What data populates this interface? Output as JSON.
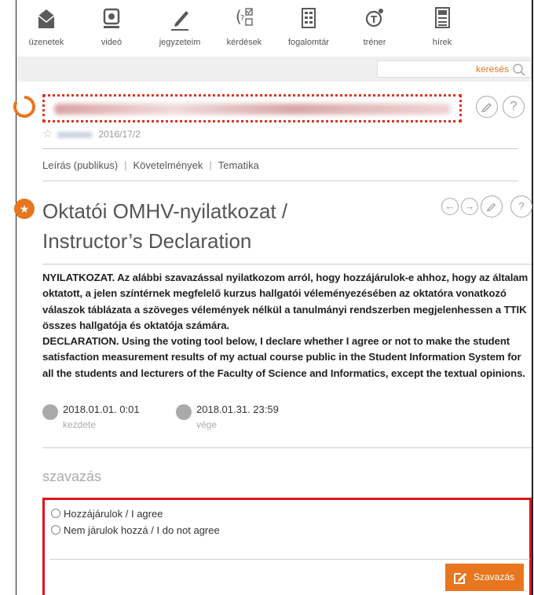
{
  "nav": {
    "items": [
      {
        "label": "üzenetek",
        "icon": "envelope-icon"
      },
      {
        "label": "videó",
        "icon": "video-icon"
      },
      {
        "label": "jegyzeteim",
        "icon": "pencil-icon"
      },
      {
        "label": "kérdések",
        "icon": "questions-icon"
      },
      {
        "label": "fogalomtár",
        "icon": "glossary-icon"
      },
      {
        "label": "tréner",
        "icon": "trainer-icon"
      },
      {
        "label": "hírek",
        "icon": "news-icon"
      }
    ]
  },
  "search": {
    "label": "keresés"
  },
  "course": {
    "semester": "2016/17/2"
  },
  "tabs": [
    "Leírás (publikus)",
    "Követelmények",
    "Tematika"
  ],
  "declaration": {
    "title": "Oktatói OMHV-nyilatkozat / Instructor’s Declaration",
    "body_hu": "NYILATKOZAT. Az alábbi szavazással nyilatkozom arról, hogy hozzájárulok-e ahhoz, hogy az általam oktatott, a jelen színtérnek megfelelő kurzus hallgatói véleményezésében az oktatóra vonatkozó válaszok táblázata a szöveges vélemények nélkül a tanulmányi rendszerben megjelenhessen a TTIK összes hallgatója és oktatója számára.",
    "body_en": "DECLARATION. Using the voting tool below, I declare whether I agree or not to make the student satisfaction measurement results of my actual course public in the Student Information System for all the students and lecturers of the Faculty of Science and Informatics, except the textual opinions.",
    "start_date": "2018.01.01. 0:01",
    "start_label": "kezdete",
    "end_date": "2018.01.31. 23:59",
    "end_label": "vége"
  },
  "vote": {
    "heading": "szavazás",
    "options": [
      "Hozzájárulok / I agree",
      "Nem járulok hozzá / I do not agree"
    ],
    "button_label": "Szavazás"
  },
  "colors": {
    "accent": "#e8761e",
    "highlight": "#e0121b"
  }
}
